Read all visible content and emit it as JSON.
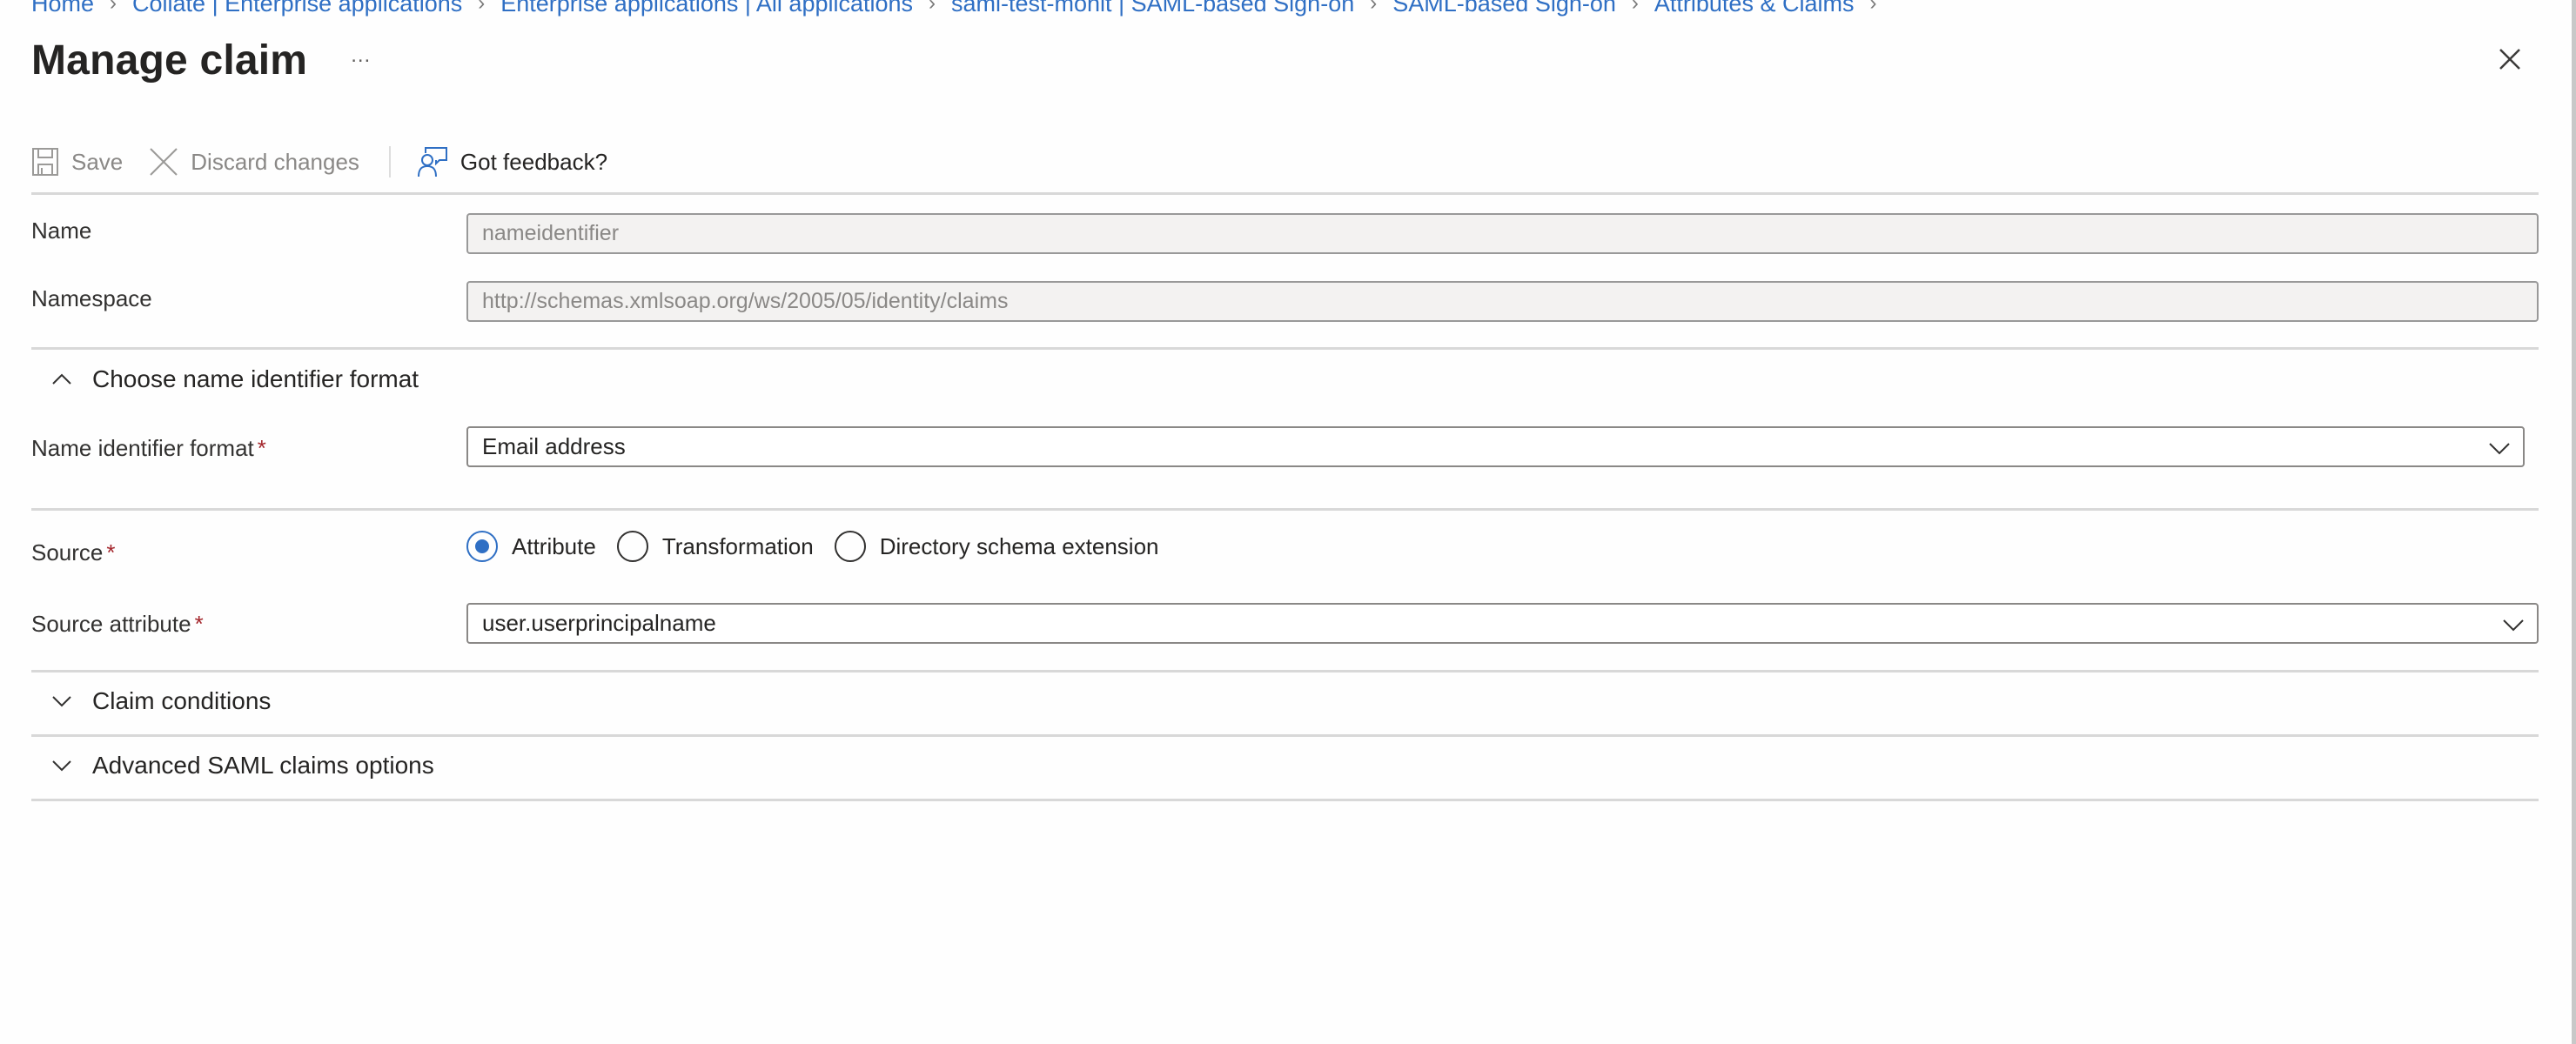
{
  "breadcrumb": [
    "Home",
    "Collate | Enterprise applications",
    "Enterprise applications | All applications",
    "saml-test-monit | SAML-based Sign-on",
    "SAML-based Sign-on",
    "Attributes & Claims"
  ],
  "breadcrumb_separator": ">",
  "header": {
    "title": "Manage claim",
    "more_label": "...",
    "close_icon": "close-icon"
  },
  "toolbar": {
    "save_label": "Save",
    "discard_label": "Discard changes",
    "feedback_label": "Got feedback?",
    "save_icon": "save-icon",
    "discard_icon": "discard-x-icon",
    "feedback_icon": "feedback-person-icon"
  },
  "form": {
    "name": {
      "label": "Name",
      "value": "nameidentifier"
    },
    "namespace": {
      "label": "Namespace",
      "value": "http://schemas.xmlsoap.org/ws/2005/05/identity/claims"
    },
    "name_id_section": {
      "label": "Choose name identifier format",
      "expanded": true
    },
    "name_id_format": {
      "label": "Name identifier format",
      "required_mark": "*",
      "value": "Email address"
    },
    "source": {
      "label": "Source",
      "required_mark": "*",
      "options": [
        {
          "label": "Attribute",
          "checked": true
        },
        {
          "label": "Transformation",
          "checked": false
        },
        {
          "label": "Directory schema extension",
          "checked": false
        }
      ]
    },
    "source_attribute": {
      "label": "Source attribute",
      "required_mark": "*",
      "value": "user.userprincipalname"
    },
    "claim_conditions": {
      "label": "Claim conditions",
      "expanded": false
    },
    "advanced_options": {
      "label": "Advanced SAML claims options",
      "expanded": false
    }
  },
  "colors": {
    "link": "#2f6fc4",
    "accent": "#2f6fc4",
    "required": "#a4262c",
    "disabled_text": "#8a8886",
    "readonly_bg": "#f3f2f1"
  }
}
